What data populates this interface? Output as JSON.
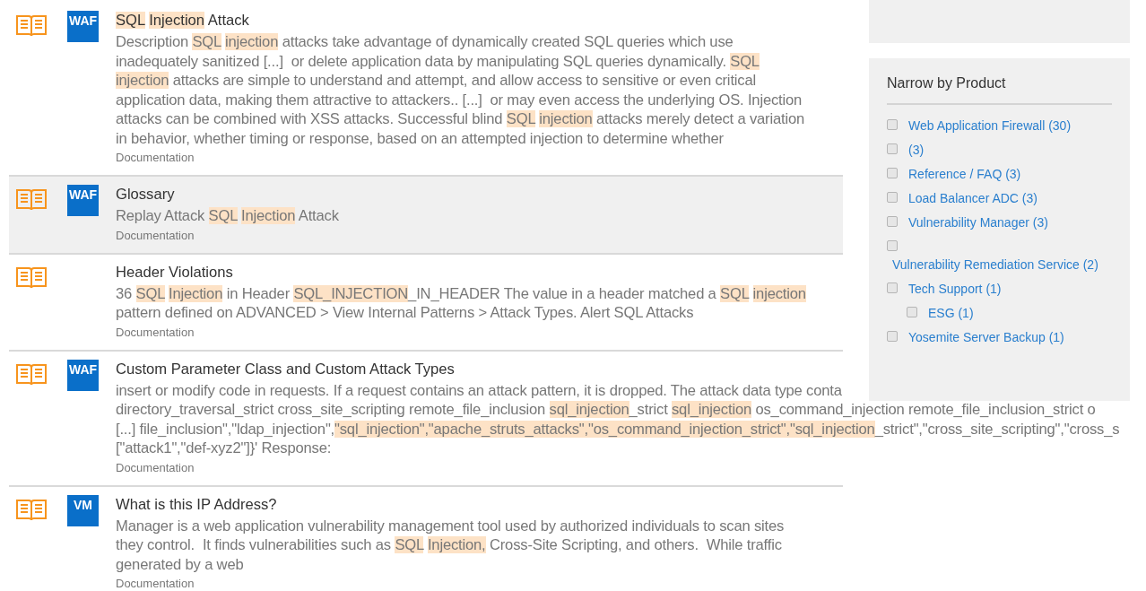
{
  "results": [
    {
      "badge": "WAF",
      "highlighted": false,
      "title": [
        {
          "text": "SQL Injection",
          "highlight": true
        },
        {
          "text": " Attack",
          "highlight": false
        }
      ],
      "lines": [
        [
          {
            "text": "Description ",
            "highlight": false
          },
          {
            "text": "SQL injection",
            "highlight": true
          },
          {
            "text": " attacks take advantage of dynamically created SQL queries which use",
            "highlight": false
          }
        ],
        [
          {
            "text": "inadequately sanitized [...]  or delete application data by manipulating SQL queries dynamically. ",
            "highlight": false
          },
          {
            "text": "SQL",
            "highlight": true
          }
        ],
        [
          {
            "text": "injection",
            "highlight": true
          },
          {
            "text": " attacks are simple to understand and attempt, and allow access to sensitive or even critical",
            "highlight": false
          }
        ],
        [
          {
            "text": "application data, making them attractive to attackers.. [...]  or may even access the underlying OS. Injection",
            "highlight": false
          }
        ],
        [
          {
            "text": "attacks can be combined with XSS attacks. Successful blind ",
            "highlight": false
          },
          {
            "text": "SQL injection",
            "highlight": true
          },
          {
            "text": " attacks merely detect a variation",
            "highlight": false
          }
        ],
        [
          {
            "text": "in behavior, whether timing or response, based on an attempted injection to determine whether",
            "highlight": false
          }
        ]
      ],
      "category": "Documentation"
    },
    {
      "badge": "WAF",
      "highlighted": true,
      "title": [
        {
          "text": "Glossary",
          "highlight": false
        }
      ],
      "lines": [
        [
          {
            "text": "Replay Attack ",
            "highlight": false
          },
          {
            "text": "SQL Injection",
            "highlight": true
          },
          {
            "text": " Attack",
            "highlight": false
          }
        ]
      ],
      "category": "Documentation"
    },
    {
      "highlighted": false,
      "title": [
        {
          "text": "Header Violations",
          "highlight": false
        }
      ],
      "lines": [
        [
          {
            "text": "36 ",
            "highlight": false
          },
          {
            "text": "SQL Injection",
            "highlight": true
          },
          {
            "text": " in Header ",
            "highlight": false
          },
          {
            "text": "SQL_INJECTION",
            "highlight": true
          },
          {
            "text": "_IN_HEADER The value in a header matched a ",
            "highlight": false
          },
          {
            "text": "SQL injection",
            "highlight": true
          }
        ],
        [
          {
            "text": "pattern defined on ADVANCED > View Internal Patterns > Attack Types. Alert SQL Attacks",
            "highlight": false
          }
        ]
      ],
      "category": "Documentation"
    },
    {
      "badge": "WAF",
      "highlighted": false,
      "title": [
        {
          "text": "Custom Parameter Class and Custom Attack Types",
          "highlight": false
        }
      ],
      "lines": [
        [
          {
            "text": "insert or modify code in requests. If a request contains an attack pattern, it is dropped. The attack data type conta",
            "highlight": false
          }
        ],
        [
          {
            "text": "directory_traversal_strict cross_site_scripting remote_file_inclusion ",
            "highlight": false
          },
          {
            "text": "sql_injection",
            "highlight": true
          },
          {
            "text": "_strict ",
            "highlight": false
          },
          {
            "text": "sql_injection",
            "highlight": true
          },
          {
            "text": " os_command_injection remote_file_inclusion_strict o",
            "highlight": false
          }
        ],
        [
          {
            "text": "[...] file_inclusion\",\"ldap_injection\",",
            "highlight": false
          },
          {
            "text": "\"sql_injection\",\"apache_struts_attacks\",\"os_command_injection_strict\",\"sql_injection",
            "highlight": true
          },
          {
            "text": "_strict\",\"cross_site_scripting\",\"cross_s",
            "highlight": false
          }
        ],
        [
          {
            "text": "[\"attack1\",\"def-xyz2\"]}' Response:",
            "highlight": false
          }
        ]
      ],
      "category": "Documentation"
    },
    {
      "badge": "VM",
      "highlighted": false,
      "title": [
        {
          "text": "What is this IP Address?",
          "highlight": false
        }
      ],
      "lines": [
        [
          {
            "text": "Manager is a web application vulnerability management tool used by authorized individuals to scan sites",
            "highlight": false
          }
        ],
        [
          {
            "text": "they control.  It finds vulnerabilities such as ",
            "highlight": false
          },
          {
            "text": "SQL Injection,",
            "highlight": true
          },
          {
            "text": " Cross-Site Scripting, and others.  While traffic",
            "highlight": false
          }
        ],
        [
          {
            "text": "generated by a web",
            "highlight": false
          }
        ]
      ],
      "category": "Documentation"
    }
  ],
  "narrow_by_product": {
    "title": "Narrow by Product",
    "items": [
      {
        "label": "Web Application Firewall (30)",
        "checked": false
      },
      {
        "label": "(3)",
        "checked": false
      },
      {
        "label": "Reference / FAQ (3)",
        "checked": false
      },
      {
        "label": "Load Balancer ADC (3)",
        "checked": false
      },
      {
        "label": "Vulnerability Manager (3)",
        "checked": false
      },
      {
        "label": "Vulnerability Remediation Service (2)",
        "checked": false,
        "wrapped": true
      },
      {
        "label": "Tech Support (1)",
        "checked": false,
        "children": [
          {
            "label": "ESG (1)",
            "checked": false
          }
        ]
      },
      {
        "label": "Yosemite Server Backup (1)",
        "checked": false
      }
    ]
  }
}
